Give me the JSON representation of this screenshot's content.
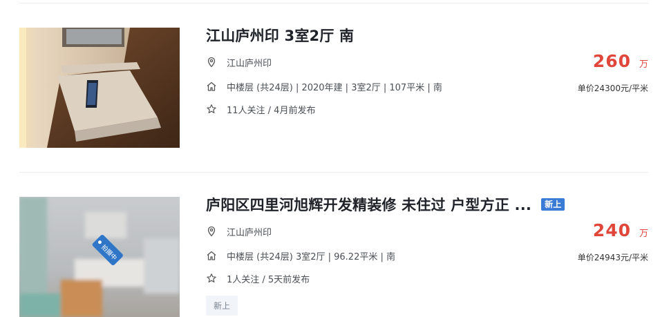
{
  "listings": [
    {
      "title": "江山庐州印 3室2厅 南",
      "badge": "",
      "community": "江山庐州印",
      "details": "中楼层 (共24层) | 2020年建 | 3室2厅 | 107平米 | 南",
      "follow": "11人关注 / 4月前发布",
      "price": "260",
      "price_unit": "万",
      "unit_price": "单价24300元/平米",
      "tag": ""
    },
    {
      "title": "庐阳区四里河旭辉开发精装修 未住过 户型方正 ...",
      "badge": "新上",
      "photo_tag": "拍摄中",
      "community": "江山庐州印",
      "details": "中楼层 (共24层) 3室2厅 | 96.22平米 | 南",
      "follow": "1人关注 / 5天前发布",
      "price": "240",
      "price_unit": "万",
      "unit_price": "单价24943元/平米",
      "tag": "新上"
    }
  ],
  "icons": {
    "location": "location-pin-icon",
    "house": "house-icon",
    "star": "star-icon"
  },
  "colors": {
    "price": "#e0463a",
    "badge": "#3a7bd5",
    "title": "#1f2329"
  }
}
